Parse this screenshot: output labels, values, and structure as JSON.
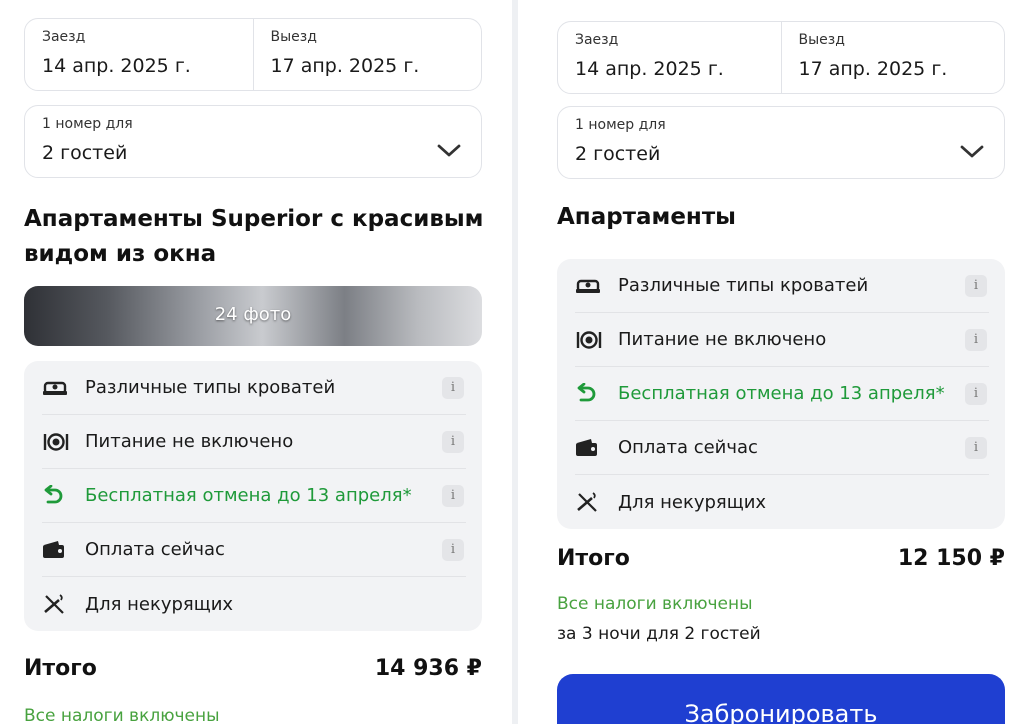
{
  "booking": {
    "checkin_label": "Заезд",
    "checkin_value": "14 апр. 2025 г.",
    "checkout_label": "Выезд",
    "checkout_value": "17 апр. 2025 г.",
    "rooms_label": "1 номер для",
    "guests_value": "2 гостей"
  },
  "left": {
    "room_title_line1": "Апартаменты Superior с красивым",
    "room_title_line2": "видом из окна",
    "photo_count": "24 фото",
    "features": [
      {
        "icon": "bed-icon",
        "text": "Различные типы кроватей"
      },
      {
        "icon": "meal-icon",
        "text": "Питание не включено"
      },
      {
        "icon": "refund-icon",
        "text": "Бесплатная отмена до 13 апреля*"
      },
      {
        "icon": "wallet-icon",
        "text": "Оплата сейчас"
      },
      {
        "icon": "no-smoking-icon",
        "text": "Для некурящих"
      }
    ],
    "total_label": "Итого",
    "total_value": "14 936 ₽",
    "tax_note": "Все налоги включены"
  },
  "right": {
    "room_title": "Апартаменты",
    "features": [
      {
        "icon": "bed-icon",
        "text": "Различные типы кроватей"
      },
      {
        "icon": "meal-icon",
        "text": "Питание не включено"
      },
      {
        "icon": "refund-icon",
        "text": "Бесплатная отмена до 13 апреля*"
      },
      {
        "icon": "wallet-icon",
        "text": "Оплата сейчас"
      },
      {
        "icon": "no-smoking-icon",
        "text": "Для некурящих"
      }
    ],
    "total_label": "Итого",
    "total_value": "12 150 ₽",
    "tax_note": "Все налоги включены",
    "nights_note": "за 3 ночи для 2 гостей",
    "book_button": "Забронировать"
  },
  "info_glyph": "i",
  "colors": {
    "accent_green": "#1f9a3a",
    "tax_green": "#48a23f",
    "primary_button": "#1f3fd1",
    "feature_bg": "#f2f3f5"
  }
}
